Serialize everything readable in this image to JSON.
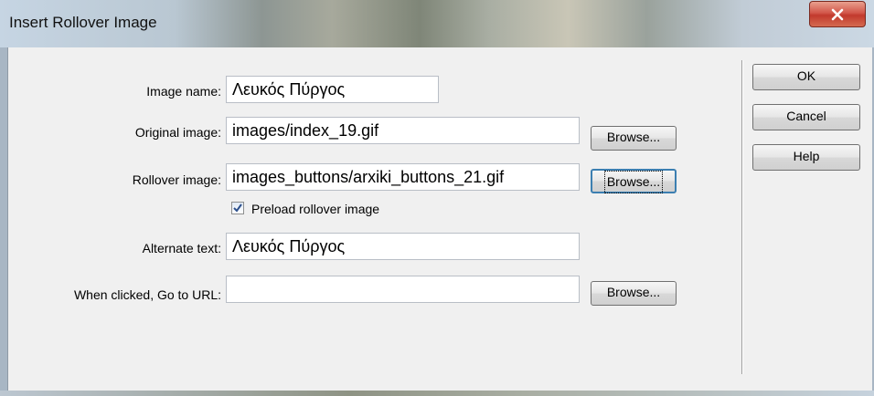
{
  "window": {
    "title": "Insert Rollover Image",
    "close_icon": "close-x-icon",
    "colors": {
      "close_button": "#c2392d",
      "background": "#f0f0f0"
    }
  },
  "form": {
    "image_name": {
      "label": "Image name:",
      "value": "Λευκός Πύργος"
    },
    "original_image": {
      "label": "Original image:",
      "value": "images/index_19.gif",
      "browse_label": "Browse..."
    },
    "rollover_image": {
      "label": "Rollover image:",
      "value": "images_buttons/arxiki_buttons_21.gif",
      "browse_label": "Browse..."
    },
    "preload": {
      "label": "Preload rollover image",
      "checked": true
    },
    "alternate_text": {
      "label": "Alternate text:",
      "value": "Λευκός Πύργος"
    },
    "url": {
      "label": "When clicked, Go to URL:",
      "value": "",
      "browse_label": "Browse..."
    }
  },
  "buttons": {
    "ok": "OK",
    "cancel": "Cancel",
    "help": "Help"
  }
}
